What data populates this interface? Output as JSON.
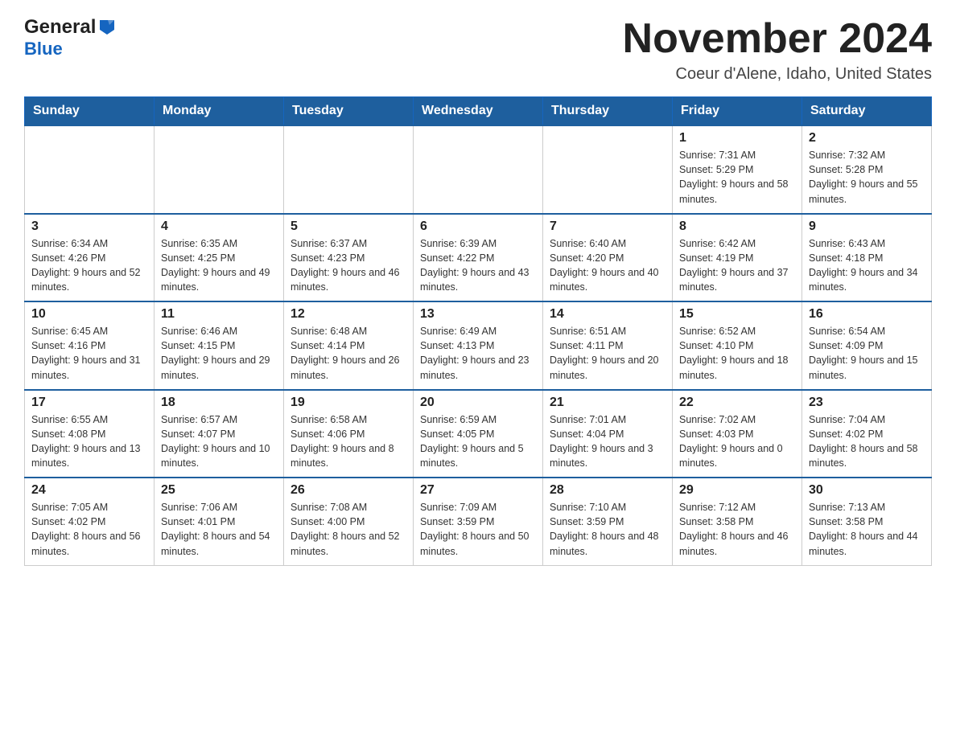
{
  "header": {
    "logo_general": "General",
    "logo_blue": "Blue",
    "month_title": "November 2024",
    "location": "Coeur d'Alene, Idaho, United States"
  },
  "weekdays": [
    "Sunday",
    "Monday",
    "Tuesday",
    "Wednesday",
    "Thursday",
    "Friday",
    "Saturday"
  ],
  "weeks": [
    [
      {
        "day": "",
        "info": ""
      },
      {
        "day": "",
        "info": ""
      },
      {
        "day": "",
        "info": ""
      },
      {
        "day": "",
        "info": ""
      },
      {
        "day": "",
        "info": ""
      },
      {
        "day": "1",
        "info": "Sunrise: 7:31 AM\nSunset: 5:29 PM\nDaylight: 9 hours and 58 minutes."
      },
      {
        "day": "2",
        "info": "Sunrise: 7:32 AM\nSunset: 5:28 PM\nDaylight: 9 hours and 55 minutes."
      }
    ],
    [
      {
        "day": "3",
        "info": "Sunrise: 6:34 AM\nSunset: 4:26 PM\nDaylight: 9 hours and 52 minutes."
      },
      {
        "day": "4",
        "info": "Sunrise: 6:35 AM\nSunset: 4:25 PM\nDaylight: 9 hours and 49 minutes."
      },
      {
        "day": "5",
        "info": "Sunrise: 6:37 AM\nSunset: 4:23 PM\nDaylight: 9 hours and 46 minutes."
      },
      {
        "day": "6",
        "info": "Sunrise: 6:39 AM\nSunset: 4:22 PM\nDaylight: 9 hours and 43 minutes."
      },
      {
        "day": "7",
        "info": "Sunrise: 6:40 AM\nSunset: 4:20 PM\nDaylight: 9 hours and 40 minutes."
      },
      {
        "day": "8",
        "info": "Sunrise: 6:42 AM\nSunset: 4:19 PM\nDaylight: 9 hours and 37 minutes."
      },
      {
        "day": "9",
        "info": "Sunrise: 6:43 AM\nSunset: 4:18 PM\nDaylight: 9 hours and 34 minutes."
      }
    ],
    [
      {
        "day": "10",
        "info": "Sunrise: 6:45 AM\nSunset: 4:16 PM\nDaylight: 9 hours and 31 minutes."
      },
      {
        "day": "11",
        "info": "Sunrise: 6:46 AM\nSunset: 4:15 PM\nDaylight: 9 hours and 29 minutes."
      },
      {
        "day": "12",
        "info": "Sunrise: 6:48 AM\nSunset: 4:14 PM\nDaylight: 9 hours and 26 minutes."
      },
      {
        "day": "13",
        "info": "Sunrise: 6:49 AM\nSunset: 4:13 PM\nDaylight: 9 hours and 23 minutes."
      },
      {
        "day": "14",
        "info": "Sunrise: 6:51 AM\nSunset: 4:11 PM\nDaylight: 9 hours and 20 minutes."
      },
      {
        "day": "15",
        "info": "Sunrise: 6:52 AM\nSunset: 4:10 PM\nDaylight: 9 hours and 18 minutes."
      },
      {
        "day": "16",
        "info": "Sunrise: 6:54 AM\nSunset: 4:09 PM\nDaylight: 9 hours and 15 minutes."
      }
    ],
    [
      {
        "day": "17",
        "info": "Sunrise: 6:55 AM\nSunset: 4:08 PM\nDaylight: 9 hours and 13 minutes."
      },
      {
        "day": "18",
        "info": "Sunrise: 6:57 AM\nSunset: 4:07 PM\nDaylight: 9 hours and 10 minutes."
      },
      {
        "day": "19",
        "info": "Sunrise: 6:58 AM\nSunset: 4:06 PM\nDaylight: 9 hours and 8 minutes."
      },
      {
        "day": "20",
        "info": "Sunrise: 6:59 AM\nSunset: 4:05 PM\nDaylight: 9 hours and 5 minutes."
      },
      {
        "day": "21",
        "info": "Sunrise: 7:01 AM\nSunset: 4:04 PM\nDaylight: 9 hours and 3 minutes."
      },
      {
        "day": "22",
        "info": "Sunrise: 7:02 AM\nSunset: 4:03 PM\nDaylight: 9 hours and 0 minutes."
      },
      {
        "day": "23",
        "info": "Sunrise: 7:04 AM\nSunset: 4:02 PM\nDaylight: 8 hours and 58 minutes."
      }
    ],
    [
      {
        "day": "24",
        "info": "Sunrise: 7:05 AM\nSunset: 4:02 PM\nDaylight: 8 hours and 56 minutes."
      },
      {
        "day": "25",
        "info": "Sunrise: 7:06 AM\nSunset: 4:01 PM\nDaylight: 8 hours and 54 minutes."
      },
      {
        "day": "26",
        "info": "Sunrise: 7:08 AM\nSunset: 4:00 PM\nDaylight: 8 hours and 52 minutes."
      },
      {
        "day": "27",
        "info": "Sunrise: 7:09 AM\nSunset: 3:59 PM\nDaylight: 8 hours and 50 minutes."
      },
      {
        "day": "28",
        "info": "Sunrise: 7:10 AM\nSunset: 3:59 PM\nDaylight: 8 hours and 48 minutes."
      },
      {
        "day": "29",
        "info": "Sunrise: 7:12 AM\nSunset: 3:58 PM\nDaylight: 8 hours and 46 minutes."
      },
      {
        "day": "30",
        "info": "Sunrise: 7:13 AM\nSunset: 3:58 PM\nDaylight: 8 hours and 44 minutes."
      }
    ]
  ]
}
